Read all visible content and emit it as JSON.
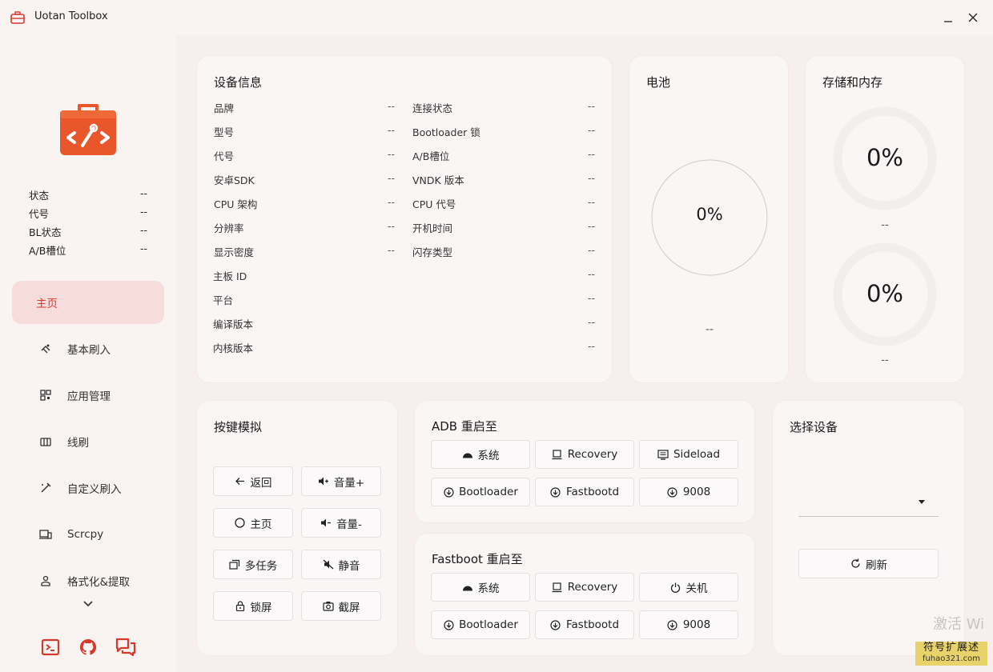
{
  "app": {
    "title": "Uotan Toolbox"
  },
  "colors": {
    "accent": "#d8382c",
    "active_bg": "#f6dcda",
    "logo": "#e8562a"
  },
  "sidebar": {
    "stats": [
      {
        "label": "状态",
        "value": "--"
      },
      {
        "label": "代号",
        "value": "--"
      },
      {
        "label": "BL状态",
        "value": "--"
      },
      {
        "label": "A/B槽位",
        "value": "--"
      }
    ],
    "nav": [
      {
        "label": "主页",
        "icon": "home-icon"
      },
      {
        "label": "基本刷入",
        "icon": "flash-icon"
      },
      {
        "label": "应用管理",
        "icon": "apps-icon"
      },
      {
        "label": "线刷",
        "icon": "wire-flash-icon"
      },
      {
        "label": "自定义刷入",
        "icon": "custom-flash-icon"
      },
      {
        "label": "Scrcpy",
        "icon": "screen-mirror-icon"
      },
      {
        "label": "格式化&提取",
        "icon": "format-icon"
      }
    ]
  },
  "device_info": {
    "title": "设备信息",
    "left": [
      {
        "label": "品牌",
        "value": "--"
      },
      {
        "label": "型号",
        "value": "--"
      },
      {
        "label": "代号",
        "value": "--"
      },
      {
        "label": "安卓SDK",
        "value": "--"
      },
      {
        "label": "CPU 架构",
        "value": "--"
      },
      {
        "label": "分辨率",
        "value": "--"
      },
      {
        "label": "显示密度",
        "value": "--"
      }
    ],
    "right": [
      {
        "label": "连接状态",
        "value": "--"
      },
      {
        "label": "Bootloader 锁",
        "value": "--"
      },
      {
        "label": "A/B槽位",
        "value": "--"
      },
      {
        "label": "VNDK 版本",
        "value": "--"
      },
      {
        "label": "CPU 代号",
        "value": "--"
      },
      {
        "label": "开机时间",
        "value": "--"
      },
      {
        "label": "闪存类型",
        "value": "--"
      }
    ],
    "full": [
      {
        "label": "主板 ID",
        "value": "--"
      },
      {
        "label": "平台",
        "value": "--"
      },
      {
        "label": "编译版本",
        "value": "--"
      },
      {
        "label": "内核版本",
        "value": "--"
      }
    ]
  },
  "battery": {
    "title": "电池",
    "percent": "0%",
    "detail": "--"
  },
  "storage": {
    "title": "存储和内存",
    "storage_percent": "0%",
    "storage_detail": "--",
    "memory_percent": "0%",
    "memory_detail": "--"
  },
  "keys": {
    "title": "按键模拟",
    "buttons": [
      "返回",
      "音量+",
      "主页",
      "音量-",
      "多任务",
      "静音",
      "锁屏",
      "截屏"
    ]
  },
  "adb_reboot": {
    "title": "ADB 重启至",
    "buttons": [
      "系统",
      "Recovery",
      "Sideload",
      "Bootloader",
      "Fastbootd",
      "9008"
    ]
  },
  "fastboot_reboot": {
    "title": "Fastboot 重启至",
    "buttons": [
      "系统",
      "Recovery",
      "关机",
      "Bootloader",
      "Fastbootd",
      "9008"
    ]
  },
  "device_select": {
    "title": "选择设备",
    "selected": "",
    "refresh_label": "刷新"
  },
  "watermark": {
    "text": "激活 Wi"
  },
  "badge": {
    "line1": "符号扩展述",
    "line2": "fuhao321.com"
  }
}
